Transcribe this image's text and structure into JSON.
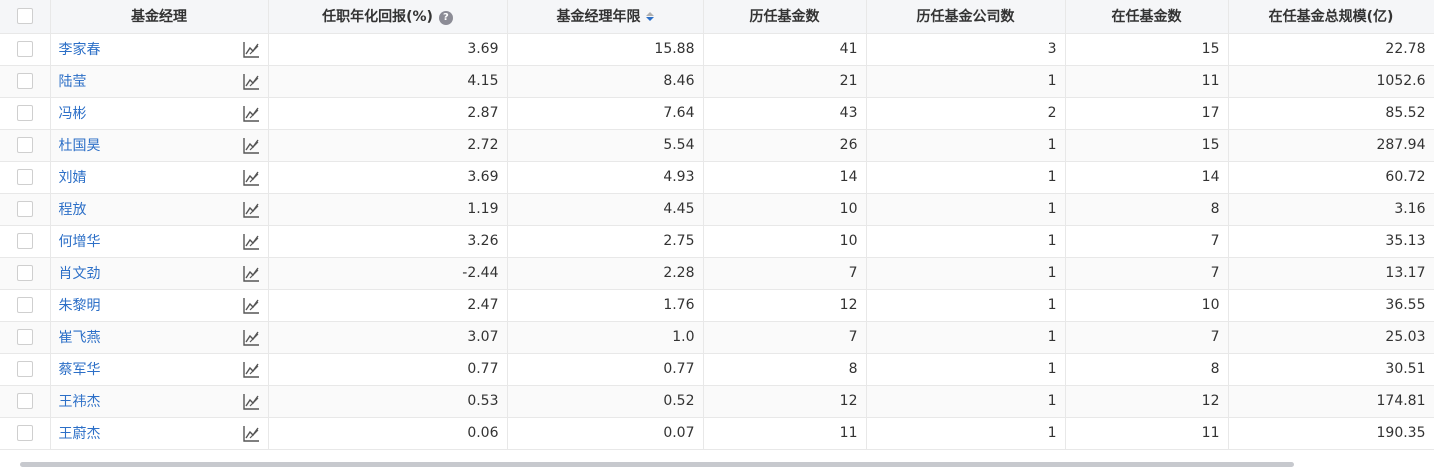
{
  "table": {
    "headers": {
      "manager": "基金经理",
      "annual_return": "任职年化回报(%)",
      "tenure": "基金经理年限",
      "funds_history": "历任基金数",
      "companies": "历任基金公司数",
      "funds_current": "在任基金数",
      "aum": "在任基金总规模(亿)"
    },
    "sort": {
      "column": "基金经理年限",
      "direction": "descending"
    },
    "rows": [
      {
        "name": "李家春",
        "annual_return": "3.69",
        "tenure": "15.88",
        "funds_history": "41",
        "companies": "3",
        "funds_current": "15",
        "aum": "22.78"
      },
      {
        "name": "陆莹",
        "annual_return": "4.15",
        "tenure": "8.46",
        "funds_history": "21",
        "companies": "1",
        "funds_current": "11",
        "aum": "1052.6"
      },
      {
        "name": "冯彬",
        "annual_return": "2.87",
        "tenure": "7.64",
        "funds_history": "43",
        "companies": "2",
        "funds_current": "17",
        "aum": "85.52"
      },
      {
        "name": "杜国昊",
        "annual_return": "2.72",
        "tenure": "5.54",
        "funds_history": "26",
        "companies": "1",
        "funds_current": "15",
        "aum": "287.94"
      },
      {
        "name": "刘婧",
        "annual_return": "3.69",
        "tenure": "4.93",
        "funds_history": "14",
        "companies": "1",
        "funds_current": "14",
        "aum": "60.72"
      },
      {
        "name": "程放",
        "annual_return": "1.19",
        "tenure": "4.45",
        "funds_history": "10",
        "companies": "1",
        "funds_current": "8",
        "aum": "3.16"
      },
      {
        "name": "何增华",
        "annual_return": "3.26",
        "tenure": "2.75",
        "funds_history": "10",
        "companies": "1",
        "funds_current": "7",
        "aum": "35.13"
      },
      {
        "name": "肖文劲",
        "annual_return": "-2.44",
        "tenure": "2.28",
        "funds_history": "7",
        "companies": "1",
        "funds_current": "7",
        "aum": "13.17"
      },
      {
        "name": "朱黎明",
        "annual_return": "2.47",
        "tenure": "1.76",
        "funds_history": "12",
        "companies": "1",
        "funds_current": "10",
        "aum": "36.55"
      },
      {
        "name": "崔飞燕",
        "annual_return": "3.07",
        "tenure": "1.0",
        "funds_history": "7",
        "companies": "1",
        "funds_current": "7",
        "aum": "25.03"
      },
      {
        "name": "蔡军华",
        "annual_return": "0.77",
        "tenure": "0.77",
        "funds_history": "8",
        "companies": "1",
        "funds_current": "8",
        "aum": "30.51"
      },
      {
        "name": "王祎杰",
        "annual_return": "0.53",
        "tenure": "0.52",
        "funds_history": "12",
        "companies": "1",
        "funds_current": "12",
        "aum": "174.81"
      },
      {
        "name": "王蔚杰",
        "annual_return": "0.06",
        "tenure": "0.07",
        "funds_history": "11",
        "companies": "1",
        "funds_current": "11",
        "aum": "190.35"
      }
    ]
  },
  "icons": {
    "help": "question-circle-icon",
    "sort": "sort-descending-icon",
    "row_chart": "line-chart-icon",
    "help_glyph": "?"
  },
  "colors": {
    "link": "#2c6fc7",
    "header_bg": "#f5f6f8",
    "border": "#e8e8e8",
    "sort_active": "#2c6fc7"
  }
}
